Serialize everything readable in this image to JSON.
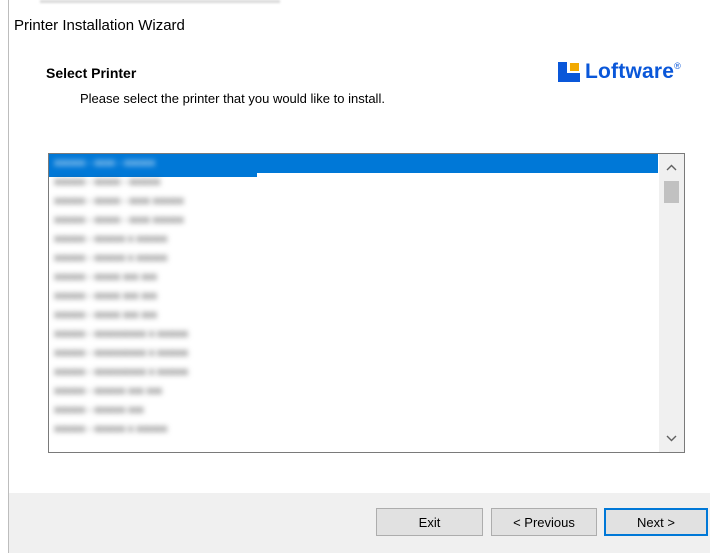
{
  "window": {
    "title": "Printer Installation Wizard"
  },
  "header": {
    "section_title": "Select Printer",
    "instruction": "Please select the printer that you would like to install.",
    "logo_text": "Loftware",
    "logo_trademark": "®"
  },
  "printer_list": {
    "selected_index": 0,
    "items": [
      "xxxxxx - xxxx - xxxxxx",
      "xxxxxx - xxxxx - xxxxxx",
      "xxxxxx - xxxxx - xxxx xxxxxx",
      "xxxxxx - xxxxx - xxxx xxxxxx",
      "xxxxxx - xxxxxx x xxxxxx",
      "xxxxxx - xxxxxx x xxxxxx",
      "xxxxxx - xxxxx xxx xxx",
      "xxxxxx - xxxxx xxx xxx",
      "xxxxxx - xxxxx xxx xxx",
      "xxxxxx - xxxxxxxxxx x xxxxxx",
      "xxxxxx - xxxxxxxxxx x xxxxxx",
      "xxxxxx - xxxxxxxxxx x xxxxxx",
      "xxxxxx - xxxxxx xxx xxx",
      "xxxxxx - xxxxxx xxx",
      "xxxxxx - xxxxxx x xxxxxx"
    ]
  },
  "buttons": {
    "exit": "Exit",
    "previous": "< Previous",
    "next": "Next >"
  },
  "scrollbar": {
    "up_arrow": "^",
    "down_arrow": "v"
  },
  "colors": {
    "selection": "#0078d7",
    "logo_blue": "#0a57d9",
    "logo_yellow": "#f2a900",
    "focus_border": "#0078d7"
  }
}
